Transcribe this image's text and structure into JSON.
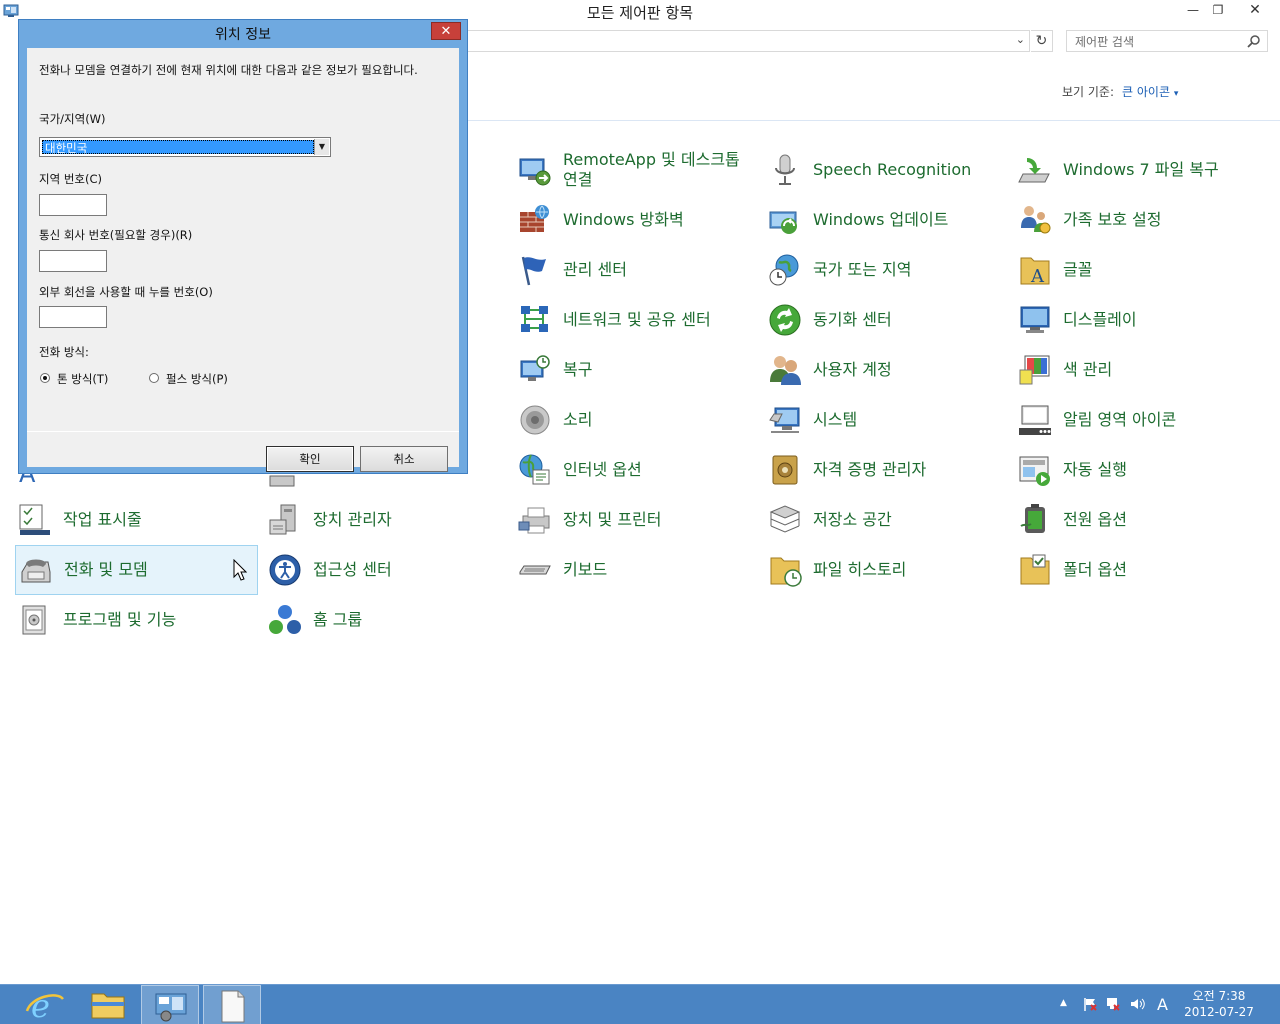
{
  "window": {
    "title": "모든 제어판 항목",
    "minimize": "—",
    "maximize": "❐",
    "close": "✕"
  },
  "search": {
    "placeholder": "제어판 검색"
  },
  "view_by": {
    "label": "보기 기준:",
    "value": "큰 아이콘",
    "arrow": "▾"
  },
  "items": {
    "remoteapp": "RemoteApp 및 데스크톱 연결",
    "speech": "Speech Recognition",
    "win7recovery": "Windows 7 파일 복구",
    "firewall": "Windows 방화벽",
    "update": "Windows 업데이트",
    "family": "가족 보호 설정",
    "action_center": "관리 센터",
    "region": "국가 또는 지역",
    "fonts": "글꼴",
    "network": "네트워크 및 공유 센터",
    "sync": "동기화 센터",
    "display": "디스플레이",
    "recovery": "복구",
    "user_accounts": "사용자 계정",
    "color": "색 관리",
    "sound": "소리",
    "system": "시스템",
    "notify_icons": "알림 영역 아이콘",
    "internet": "인터넷 옵션",
    "credential": "자격 증명 관리자",
    "autoplay": "자동 실행",
    "taskbar_nav": "작업 표시줄",
    "device_manager": "장치 관리자",
    "devices_printers": "장치 및 프린터",
    "storage": "저장소 공간",
    "power": "전원 옵션",
    "phone_modem": "전화 및 모뎀",
    "ease_access": "접근성 센터",
    "keyboard": "키보드",
    "file_history": "파일 히스토리",
    "folder_options": "폴더 옵션",
    "programs": "프로그램 및 기능",
    "homegroup": "홈 그룹"
  },
  "dialog": {
    "title": "위치 정보",
    "close": "✕",
    "intro": "전화나 모뎀을 연결하기 전에 현재 위치에 대한 다음과 같은 정보가 필요합니다.",
    "country_label": "국가/지역(W)",
    "country_value": "대한민국",
    "area_label": "지역 번호(C)",
    "area_value": "",
    "carrier_label": "통신 회사 번호(필요할 경우)(R)",
    "carrier_value": "",
    "outside_label": "외부 회선을 사용할 때 누를 번호(O)",
    "outside_value": "",
    "dial_label": "전화 방식:",
    "tone": "톤 방식(T)",
    "pulse": "펄스 방식(P)",
    "dial_selected": "tone",
    "ok": "확인",
    "cancel": "취소"
  },
  "taskbar": {
    "ime": "A",
    "time": "오전 7:38",
    "date": "2012-07-27",
    "tray_arrow": "▲"
  }
}
